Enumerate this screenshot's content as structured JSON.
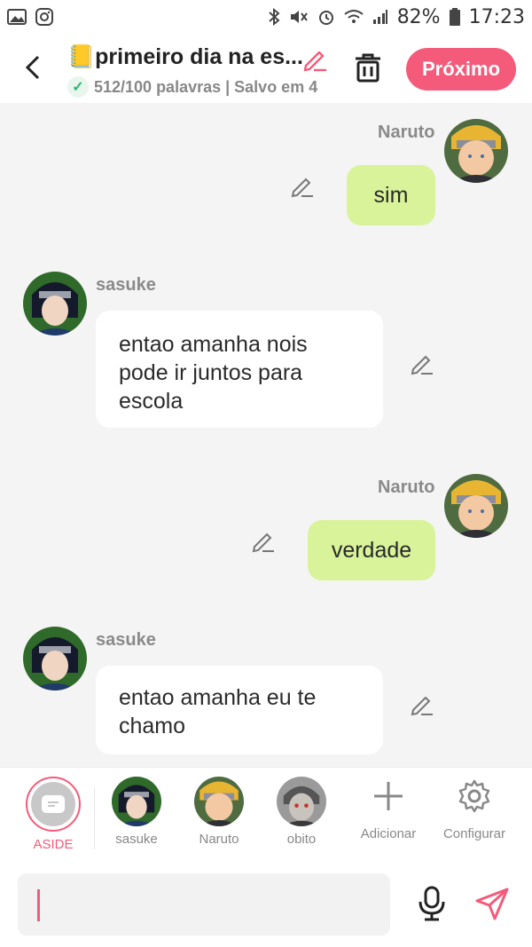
{
  "status": {
    "battery": "82%",
    "time": "17:23"
  },
  "header": {
    "title_emoji": "📒",
    "title": "primeiro dia na es...",
    "subtitle": "512/100 palavras | Salvo em 4",
    "next_label": "Próximo"
  },
  "messages": [
    {
      "sender": "Naruto",
      "text": "sim",
      "side": "right"
    },
    {
      "sender": "sasuke",
      "text": "entao amanha nois pode ir juntos para escola",
      "side": "left"
    },
    {
      "sender": "Naruto",
      "text": "verdade",
      "side": "right"
    },
    {
      "sender": "sasuke",
      "text": "entao amanha eu te chamo",
      "side": "left"
    }
  ],
  "characters": [
    {
      "label": "ASIDE"
    },
    {
      "label": "sasuke"
    },
    {
      "label": "Naruto"
    },
    {
      "label": "obito"
    },
    {
      "label": "Adicionar"
    },
    {
      "label": "Configurar"
    }
  ],
  "colors": {
    "accent": "#f45b7a",
    "bubble_right": "#d9f39a",
    "bubble_left": "#ffffff"
  }
}
